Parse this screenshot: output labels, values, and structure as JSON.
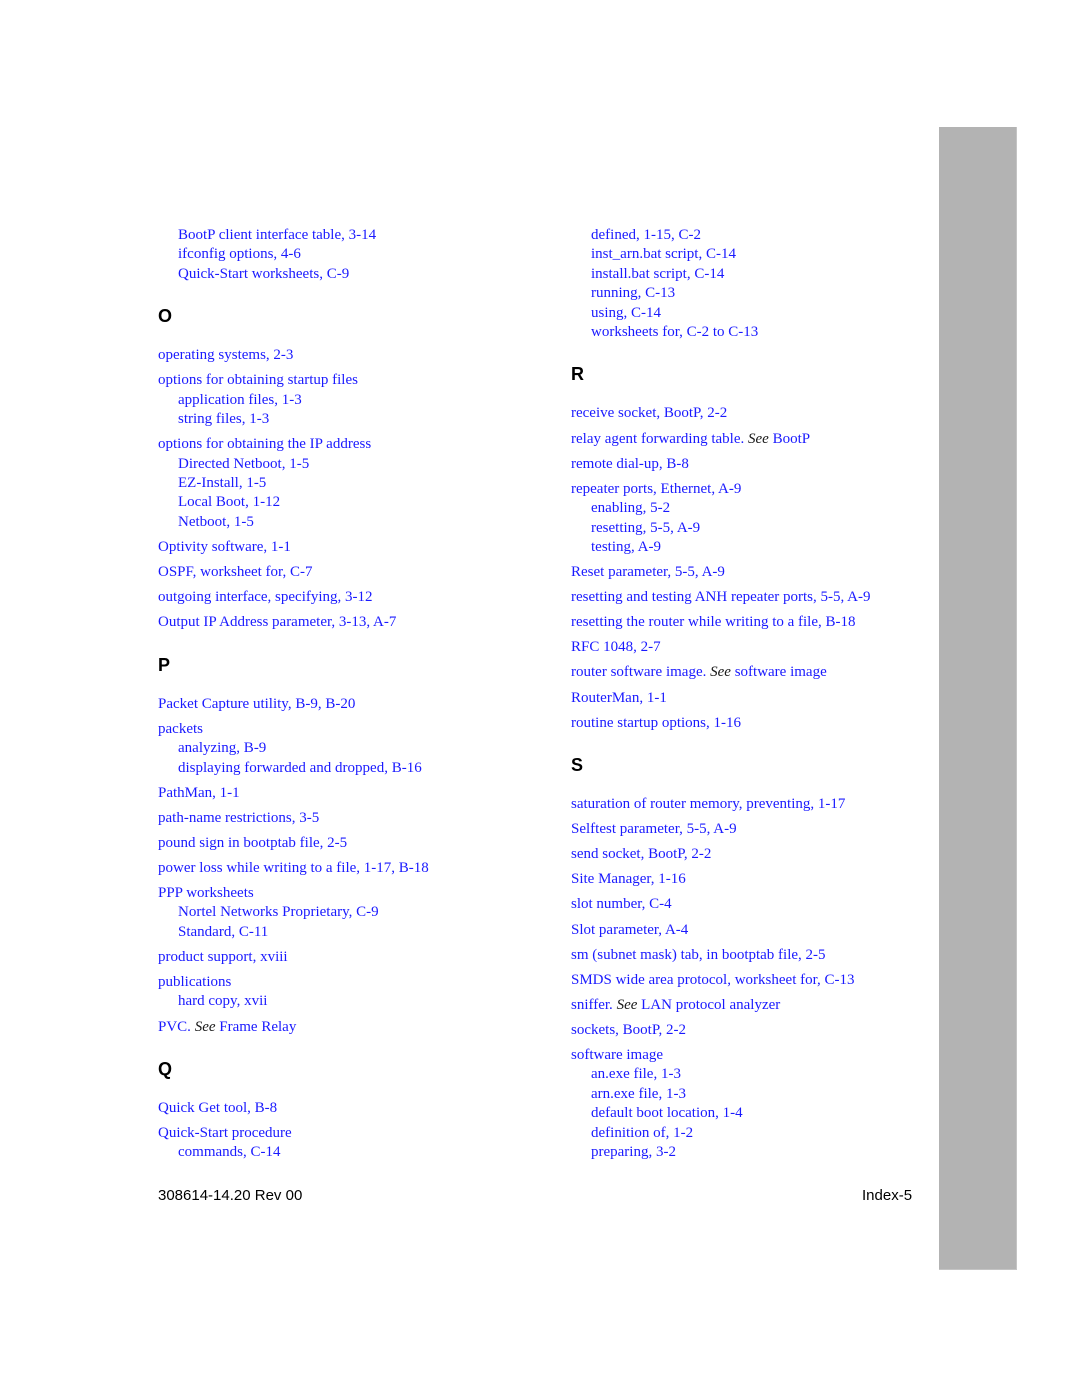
{
  "footer": {
    "doc_number": "308614-14.20 Rev 00",
    "page_label": "Index-5"
  },
  "left_column": [
    {
      "type": "sub",
      "text": "BootP client interface table, 3-14"
    },
    {
      "type": "sub",
      "text": "ifconfig options, 4-6"
    },
    {
      "type": "sub",
      "text": "Quick-Start worksheets, C-9"
    },
    {
      "type": "letter",
      "text": "O"
    },
    {
      "type": "entry",
      "text": "operating systems, 2-3"
    },
    {
      "type": "entry",
      "text": "options for obtaining startup files"
    },
    {
      "type": "sub",
      "text": "application files, 1-3"
    },
    {
      "type": "sub",
      "text": "string files, 1-3"
    },
    {
      "type": "entry",
      "text": "options for obtaining the IP address"
    },
    {
      "type": "sub",
      "text": "Directed Netboot, 1-5"
    },
    {
      "type": "sub",
      "text": "EZ-Install, 1-5"
    },
    {
      "type": "sub",
      "text": "Local Boot, 1-12"
    },
    {
      "type": "sub",
      "text": "Netboot, 1-5"
    },
    {
      "type": "entry",
      "text": "Optivity software, 1-1"
    },
    {
      "type": "entry",
      "text": "OSPF, worksheet for, C-7"
    },
    {
      "type": "entry",
      "text": "outgoing interface, specifying, 3-12"
    },
    {
      "type": "entry",
      "text": "Output IP Address parameter, 3-13, A-7"
    },
    {
      "type": "letter",
      "text": "P"
    },
    {
      "type": "entry",
      "text": "Packet Capture utility, B-9, B-20"
    },
    {
      "type": "entry",
      "text": "packets"
    },
    {
      "type": "sub",
      "text": "analyzing, B-9"
    },
    {
      "type": "sub",
      "text": "displaying forwarded and dropped, B-16"
    },
    {
      "type": "entry",
      "text": "PathMan, 1-1"
    },
    {
      "type": "entry",
      "text": "path-name restrictions, 3-5"
    },
    {
      "type": "entry",
      "text": "pound sign in bootptab file, 2-5"
    },
    {
      "type": "entry",
      "text": "power loss while writing to a file, 1-17, B-18"
    },
    {
      "type": "entry",
      "text": "PPP worksheets"
    },
    {
      "type": "sub",
      "text": "Nortel Networks Proprietary, C-9"
    },
    {
      "type": "sub",
      "text": "Standard, C-11"
    },
    {
      "type": "entry",
      "text": "product support, xviii"
    },
    {
      "type": "entry",
      "text": "publications"
    },
    {
      "type": "sub",
      "text": "hard copy, xvii"
    },
    {
      "type": "entry",
      "text": "PVC. ",
      "see": "See",
      "after": " Frame Relay"
    },
    {
      "type": "letter",
      "text": "Q"
    },
    {
      "type": "entry",
      "text": "Quick Get tool, B-8"
    },
    {
      "type": "entry",
      "text": "Quick-Start procedure"
    },
    {
      "type": "sub",
      "text": "commands, C-14"
    }
  ],
  "right_column": [
    {
      "type": "sub",
      "text": "defined, 1-15, C-2"
    },
    {
      "type": "sub",
      "text": "inst_arn.bat script, C-14"
    },
    {
      "type": "sub",
      "text": "install.bat script, C-14"
    },
    {
      "type": "sub",
      "text": "running, C-13"
    },
    {
      "type": "sub",
      "text": "using, C-14"
    },
    {
      "type": "sub",
      "text": "worksheets for, C-2 to C-13"
    },
    {
      "type": "letter",
      "text": "R"
    },
    {
      "type": "entry",
      "text": "receive socket, BootP, 2-2"
    },
    {
      "type": "entry",
      "text": "relay agent forwarding table. ",
      "see": "See",
      "after": " BootP"
    },
    {
      "type": "entry",
      "text": "remote dial-up, B-8"
    },
    {
      "type": "entry",
      "text": "repeater ports, Ethernet, A-9"
    },
    {
      "type": "sub",
      "text": "enabling, 5-2"
    },
    {
      "type": "sub",
      "text": "resetting, 5-5, A-9"
    },
    {
      "type": "sub",
      "text": "testing, A-9"
    },
    {
      "type": "entry",
      "text": "Reset parameter, 5-5, A-9"
    },
    {
      "type": "entry",
      "text": "resetting and testing ANH repeater ports, 5-5, A-9"
    },
    {
      "type": "entry",
      "text": "resetting the router while writing to a file, B-18"
    },
    {
      "type": "entry",
      "text": "RFC 1048, 2-7"
    },
    {
      "type": "entry",
      "text": "router software image. ",
      "see": "See",
      "after": " software image"
    },
    {
      "type": "entry",
      "text": "RouterMan, 1-1"
    },
    {
      "type": "entry",
      "text": "routine startup options, 1-16"
    },
    {
      "type": "letter",
      "text": "S"
    },
    {
      "type": "entry",
      "text": "saturation of router memory, preventing, 1-17"
    },
    {
      "type": "entry",
      "text": "Selftest parameter, 5-5, A-9"
    },
    {
      "type": "entry",
      "text": "send socket, BootP, 2-2"
    },
    {
      "type": "entry",
      "text": "Site Manager, 1-16"
    },
    {
      "type": "entry",
      "text": "slot number, C-4"
    },
    {
      "type": "entry",
      "text": "Slot parameter, A-4"
    },
    {
      "type": "entry",
      "text": "sm (subnet mask) tab, in bootptab file, 2-5"
    },
    {
      "type": "entry",
      "text": "SMDS wide area protocol, worksheet for, C-13"
    },
    {
      "type": "entry",
      "text": "sniffer. ",
      "see": "See",
      "after": " LAN protocol analyzer"
    },
    {
      "type": "entry",
      "text": "sockets, BootP, 2-2"
    },
    {
      "type": "entry",
      "text": "software image"
    },
    {
      "type": "sub",
      "text": "an.exe file, 1-3"
    },
    {
      "type": "sub",
      "text": "arn.exe file, 1-3"
    },
    {
      "type": "sub",
      "text": "default boot location, 1-4"
    },
    {
      "type": "sub",
      "text": "definition of, 1-2"
    },
    {
      "type": "sub",
      "text": "preparing, 3-2"
    }
  ]
}
